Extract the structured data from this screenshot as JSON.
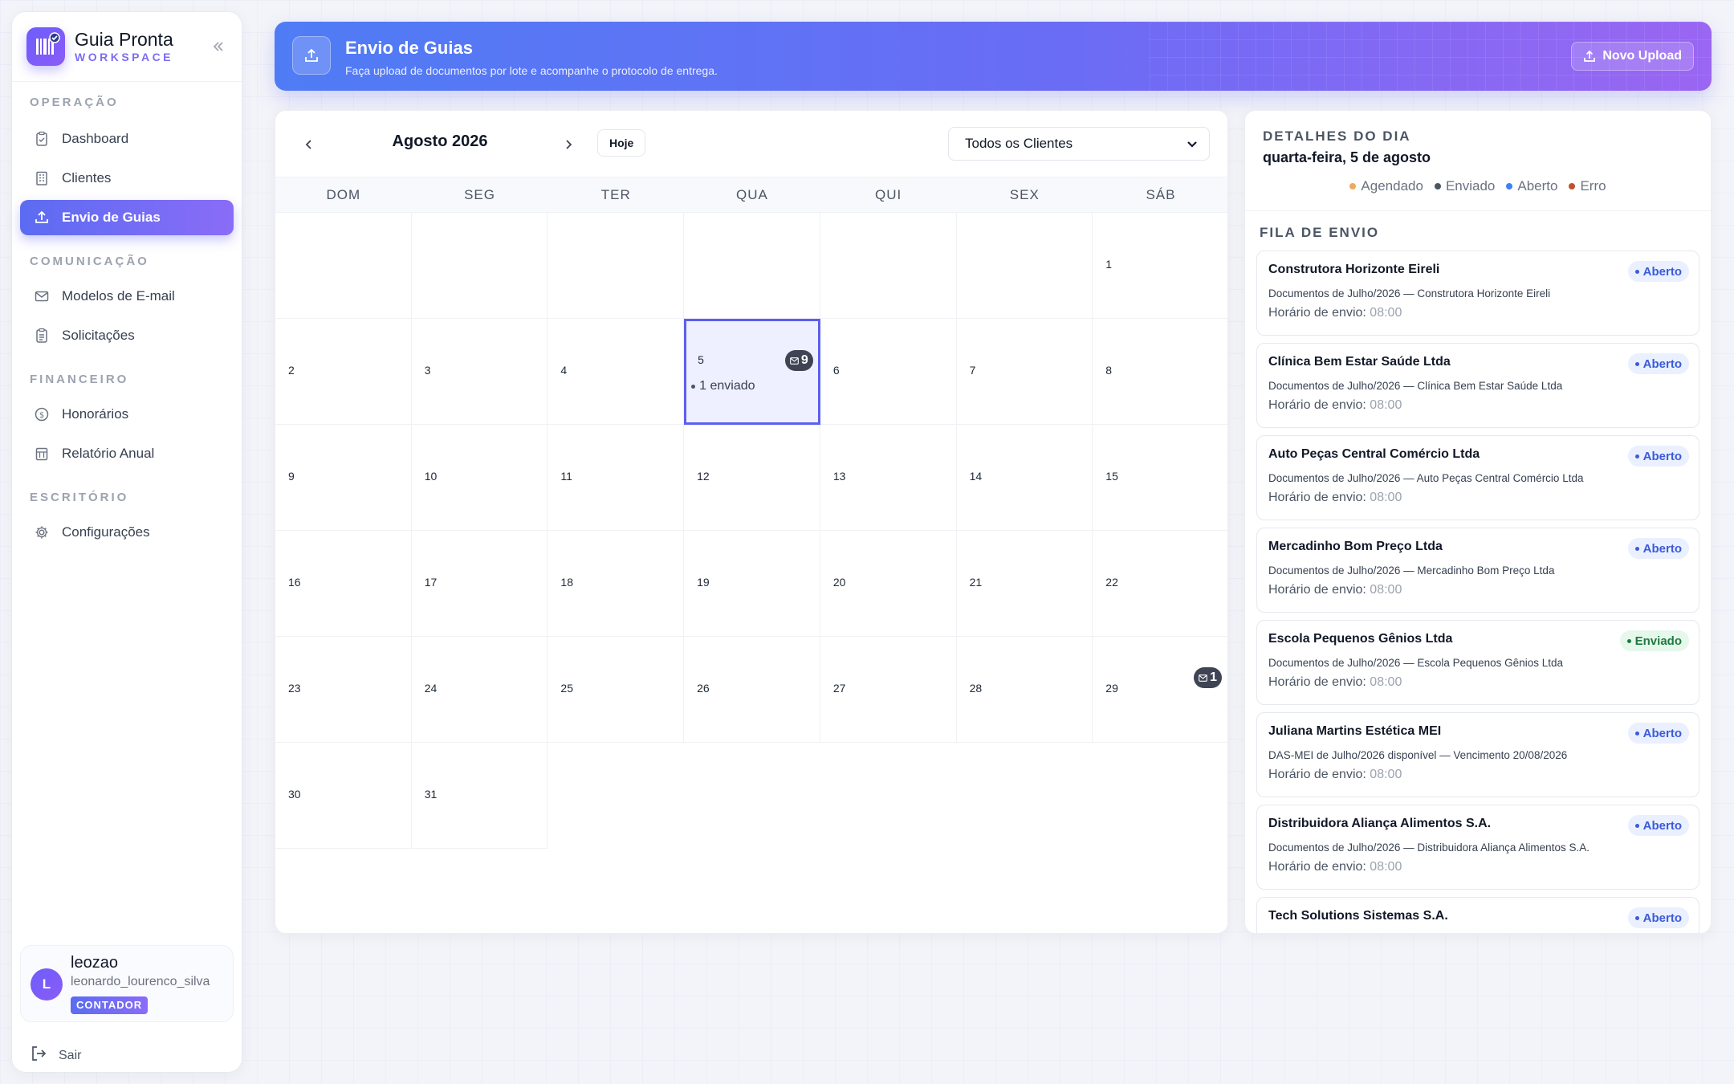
{
  "colors": {
    "accent": "#6366f1",
    "legend_agendado": "#f0a860",
    "legend_enviado": "#4b5563",
    "legend_aberto": "#3b82f6",
    "legend_erro": "#c0502b"
  },
  "brand": {
    "name": "Guia Pronta",
    "subtitle": "WORKSPACE",
    "logo_icon": "barcode-check-icon",
    "collapse_icon": "double-chevron-left-icon"
  },
  "sidebar": {
    "sections": [
      {
        "title": "OPERAÇÃO",
        "items": [
          {
            "label": "Dashboard",
            "icon": "clipboard-check-icon"
          },
          {
            "label": "Clientes",
            "icon": "building-icon"
          },
          {
            "label": "Envio de Guias",
            "icon": "upload-icon",
            "active": true
          }
        ]
      },
      {
        "title": "COMUNICAÇÃO",
        "items": [
          {
            "label": "Modelos de E-mail",
            "icon": "mail-icon"
          },
          {
            "label": "Solicitações",
            "icon": "clipboard-list-icon"
          }
        ]
      },
      {
        "title": "FINANCEIRO",
        "items": [
          {
            "label": "Honorários",
            "icon": "dollar-circle-icon"
          },
          {
            "label": "Relatório Anual",
            "icon": "calendar-report-icon"
          }
        ]
      },
      {
        "title": "ESCRITÓRIO",
        "items": [
          {
            "label": "Configurações",
            "icon": "gear-icon"
          }
        ]
      }
    ]
  },
  "user": {
    "initial": "L",
    "name": "leozao",
    "email": "leonardo_lourenco_silva",
    "role": "CONTADOR"
  },
  "logout_label": "Sair",
  "header": {
    "title": "Envio de Guias",
    "subtitle": "Faça upload de documentos por lote e acompanhe o protocolo de entrega.",
    "upload_button": "Novo Upload"
  },
  "calendar": {
    "month_label": "Agosto 2026",
    "today_button": "Hoje",
    "client_filter": "Todos os Clientes",
    "weekdays": [
      "DOM",
      "SEG",
      "TER",
      "QUA",
      "QUI",
      "SEX",
      "SÁB"
    ],
    "first_weekday_index": 6,
    "days_in_month": 31,
    "selected_day": 5,
    "day_badges": {
      "5": "9",
      "29": "1"
    },
    "day_notes": {
      "5": "1 enviado"
    }
  },
  "details": {
    "title": "DETALHES DO DIA",
    "date": "quarta-feira, 5 de agosto",
    "legend": [
      {
        "label": "Agendado",
        "color": "#f0a860"
      },
      {
        "label": "Enviado",
        "color": "#4b5563"
      },
      {
        "label": "Aberto",
        "color": "#3b82f6"
      },
      {
        "label": "Erro",
        "color": "#c0502b"
      }
    ],
    "queue_title": "FILA DE ENVIO",
    "time_label": "Horário de envio:",
    "queue": [
      {
        "name": "Construtora Horizonte Eireli",
        "desc": "Documentos de Julho/2026 — Construtora Horizonte Eireli",
        "time": "08:00",
        "status": "Aberto"
      },
      {
        "name": "Clínica Bem Estar Saúde Ltda",
        "desc": "Documentos de Julho/2026 — Clínica Bem Estar Saúde Ltda",
        "time": "08:00",
        "status": "Aberto"
      },
      {
        "name": "Auto Peças Central Comércio Ltda",
        "desc": "Documentos de Julho/2026 — Auto Peças Central Comércio Ltda",
        "time": "08:00",
        "status": "Aberto"
      },
      {
        "name": "Mercadinho Bom Preço Ltda",
        "desc": "Documentos de Julho/2026 — Mercadinho Bom Preço Ltda",
        "time": "08:00",
        "status": "Aberto"
      },
      {
        "name": "Escola Pequenos Gênios Ltda",
        "desc": "Documentos de Julho/2026 — Escola Pequenos Gênios Ltda",
        "time": "08:00",
        "status": "Enviado"
      },
      {
        "name": "Juliana Martins Estética MEI",
        "desc": "DAS-MEI de Julho/2026 disponível — Vencimento 20/08/2026",
        "time": "08:00",
        "status": "Aberto"
      },
      {
        "name": "Distribuidora Aliança Alimentos S.A.",
        "desc": "Documentos de Julho/2026 — Distribuidora Aliança Alimentos S.A.",
        "time": "08:00",
        "status": "Aberto"
      },
      {
        "name": "Tech Solutions Sistemas S.A.",
        "desc": "",
        "time": "",
        "status": "Aberto"
      }
    ]
  }
}
